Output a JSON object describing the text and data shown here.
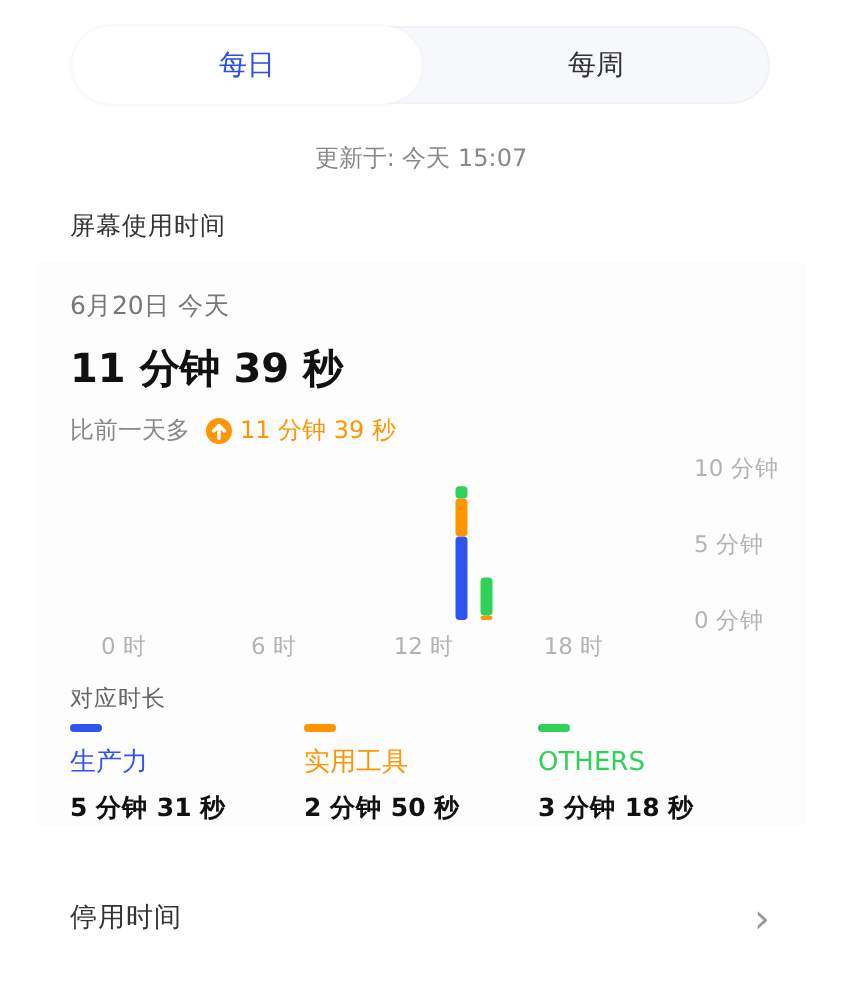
{
  "tabs": [
    {
      "label": "每日",
      "selected": true
    },
    {
      "label": "每周",
      "selected": false
    }
  ],
  "updated": "更新于: 今天 15:07",
  "section_title": "屏幕使用时间",
  "date": "6月20日 今天",
  "total": "11 分钟 39 秒",
  "comparison": {
    "label": "比前一天多",
    "increased": true,
    "amount": "11 分钟 39 秒"
  },
  "chart_data": {
    "type": "bar",
    "stacked": true,
    "x": [
      13.5,
      14.5
    ],
    "series": [
      {
        "name": "生产力",
        "color": "#2f55f0",
        "values": [
          5.5,
          null
        ]
      },
      {
        "name": "实用工具",
        "color": "#ff9500",
        "values": [
          2.5,
          0.3
        ]
      },
      {
        "name": "OTHERS",
        "color": "#30d158",
        "values": [
          0.8,
          2.5
        ]
      }
    ],
    "xlim": [
      0,
      18
    ],
    "ylim": [
      0,
      10
    ],
    "xticks": [
      {
        "value": 0,
        "label": "0 时"
      },
      {
        "value": 6,
        "label": "6 时"
      },
      {
        "value": 12,
        "label": "12 时"
      },
      {
        "value": 18,
        "label": "18 时"
      }
    ],
    "yticks": [
      {
        "value": 0,
        "label": "0 分钟"
      },
      {
        "value": 5,
        "label": "5 分钟"
      },
      {
        "value": 10,
        "label": "10 分钟"
      }
    ]
  },
  "legend_title": "对应时长",
  "legend_durations": [
    "5 分钟 31 秒",
    "2 分钟 50 秒",
    "3 分钟 18 秒"
  ],
  "link_row": {
    "label": "停用时间",
    "chevron": "›"
  }
}
